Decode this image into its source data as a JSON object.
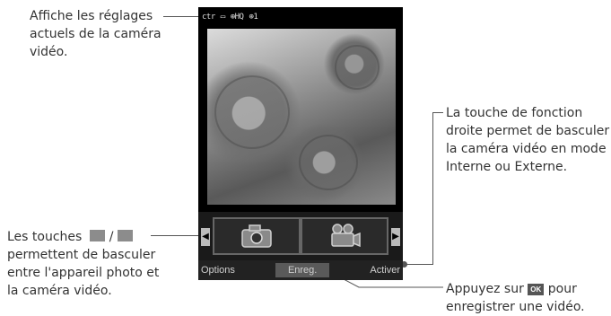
{
  "phone": {
    "status_icons": [
      "camcorder-status-icon",
      "quality-icon",
      "resolution-icon",
      "count-icon"
    ],
    "status_text": {
      "icon1": "ctr",
      "icon2": "▭",
      "icon3": "⊕HQ",
      "icon4": "⊕1"
    },
    "softkeys": {
      "left": "Options",
      "center": "Enreg.",
      "right": "Activer"
    },
    "mode_tiles": [
      "camera",
      "video-camera"
    ]
  },
  "annotations": {
    "top_left": "Affiche les réglages actuels de la caméra vidéo.",
    "top_left_lines": [
      "Affiche les réglages",
      "actuels de la caméra",
      "vidéo."
    ],
    "right": [
      "La touche de fonction",
      "droite permet de basculer",
      "la caméra vidéo en mode",
      "Interne ou Externe."
    ],
    "bottom_left": {
      "prefix": "Les touches",
      "separator": "/",
      "lines": [
        "permettent de basculer",
        "entre l'appareil photo et",
        "la caméra vidéo."
      ]
    },
    "bottom_right": {
      "prefix": "Appuyez sur",
      "ok_label": "OK",
      "suffix": "pour",
      "line2": "enregistrer une vidéo."
    }
  }
}
